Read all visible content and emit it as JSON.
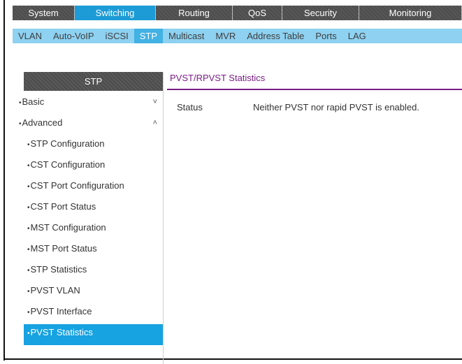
{
  "main_tabs": [
    {
      "label": "System",
      "width": 89
    },
    {
      "label": "Switching",
      "width": 116
    },
    {
      "label": "Routing",
      "width": 110
    },
    {
      "label": "QoS",
      "width": 71
    },
    {
      "label": "Security",
      "width": 110
    },
    {
      "label": "Monitoring",
      "width": 147
    }
  ],
  "main_active_index": 1,
  "sub_tabs": [
    "VLAN",
    "Auto-VoIP",
    "iSCSI",
    "STP",
    "Multicast",
    "MVR",
    "Address Table",
    "Ports",
    "LAG"
  ],
  "sub_active_index": 3,
  "sidebar": {
    "title": "STP",
    "items": [
      {
        "label": "Basic",
        "level": "top",
        "chevron": "˅"
      },
      {
        "label": "Advanced",
        "level": "top",
        "chevron": "˄"
      },
      {
        "label": "STP Configuration",
        "level": "sub"
      },
      {
        "label": "CST Configuration",
        "level": "sub"
      },
      {
        "label": "CST Port Configuration",
        "level": "sub"
      },
      {
        "label": "CST Port Status",
        "level": "sub"
      },
      {
        "label": "MST Configuration",
        "level": "sub"
      },
      {
        "label": "MST Port Status",
        "level": "sub"
      },
      {
        "label": "STP Statistics",
        "level": "sub"
      },
      {
        "label": "PVST VLAN",
        "level": "sub"
      },
      {
        "label": "PVST Interface",
        "level": "sub"
      },
      {
        "label": "PVST Statistics",
        "level": "sub",
        "active": true
      }
    ]
  },
  "content": {
    "title": "PVST/RPVST Statistics",
    "status_label": "Status",
    "status_value": "Neither PVST nor rapid PVST is enabled."
  },
  "colors": {
    "accent": "#1c9bd6",
    "subbar": "#8ed1f1",
    "title": "#7a1d86"
  }
}
